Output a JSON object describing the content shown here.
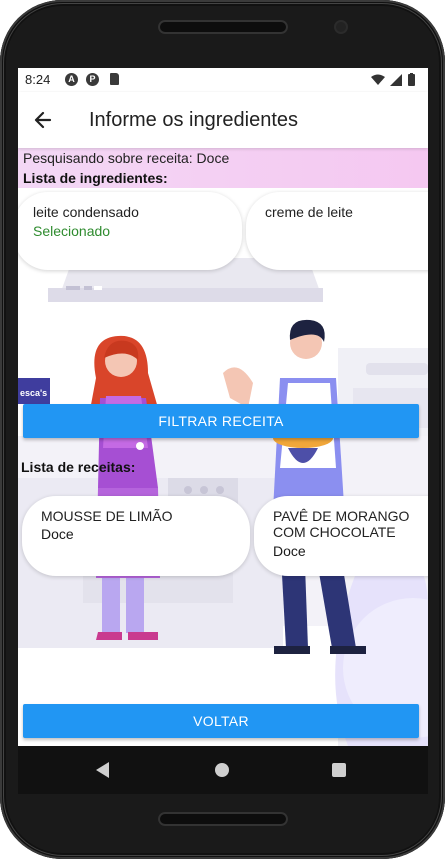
{
  "status_bar": {
    "time": "8:24",
    "icons": [
      "a-notification-icon",
      "p-notification-icon",
      "sd-card-icon",
      "wifi-icon",
      "signal-icon",
      "battery-icon"
    ]
  },
  "app_bar": {
    "title": "Informe os ingredientes",
    "back_icon": "arrow-left-icon"
  },
  "search": {
    "info": "Pesquisando sobre receita: Doce"
  },
  "ingredients": {
    "heading": "Lista de ingredientes:",
    "items": [
      {
        "name": "leite condensado",
        "status": "Selecionado"
      },
      {
        "name": "creme de leite",
        "status": ""
      }
    ]
  },
  "filter_button": {
    "label": "FILTRAR RECEITA"
  },
  "recipes": {
    "heading": "Lista de receitas:",
    "items": [
      {
        "title": "MOUSSE DE LIMÃO",
        "category": "Doce"
      },
      {
        "title": "PAVÊ DE MORANGO COM CHOCOLATE",
        "category": "Doce"
      }
    ]
  },
  "illustration": {
    "sign_text": "esca's"
  },
  "back_button": {
    "label": "VOLTAR"
  },
  "colors": {
    "primary": "#2196f3",
    "selected_green": "#2e8b2e",
    "search_bg": "#f3d7f5"
  }
}
